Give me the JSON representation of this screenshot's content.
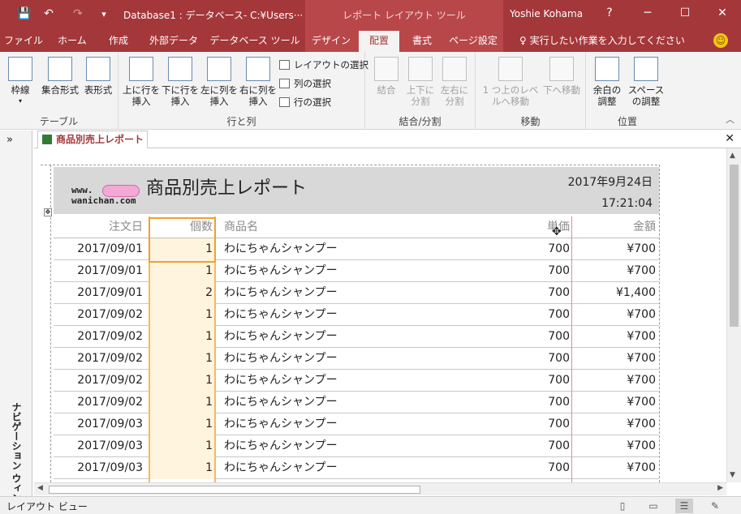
{
  "titlebar": {
    "doc_title": "Database1 : データベース- C:¥Users···",
    "context_title": "レポート レイアウト ツール",
    "user": "Yoshie Kohama",
    "help": "?",
    "minimize": "─",
    "maximize": "☐",
    "close": "✕",
    "save_icon": "💾",
    "undo_icon": "↶",
    "redo_icon": "↷",
    "customize_icon": "▾"
  },
  "tabs": [
    {
      "label": "ファイル"
    },
    {
      "label": "ホーム"
    },
    {
      "label": "作成"
    },
    {
      "label": "外部データ"
    },
    {
      "label": "データベース ツール"
    },
    {
      "label": "デザイン"
    },
    {
      "label": "配置"
    },
    {
      "label": "書式"
    },
    {
      "label": "ページ設定"
    }
  ],
  "tell_me": "♀ 実行したい作業を入力してください",
  "ribbon": {
    "groups": {
      "table": "テーブル",
      "rows_cols": "行と列",
      "merge": "結合/分割",
      "move": "移動",
      "position": "位置"
    },
    "buttons": {
      "gridlines": "枠線",
      "stacked": "集合形式",
      "tabular": "表形式",
      "insert_above": "上に行を挿入",
      "insert_below": "下に行を挿入",
      "insert_left": "左に列を挿入",
      "insert_right": "右に列を挿入",
      "select_layout": "レイアウトの選択",
      "select_column": "列の選択",
      "select_row": "行の選択",
      "merge": "結合",
      "split_vertical": "上下に分割",
      "split_horizontal": "左右に分割",
      "move_up": "1 つ上のレベルへ移動",
      "move_down": "下へ移動",
      "margins": "余白の調整",
      "padding": "スペースの調整"
    }
  },
  "nav_pane": {
    "toggle": "»",
    "label": "ナビゲーション ウィンドウ"
  },
  "document_tab": {
    "title": "商品別売上レポート",
    "close": "✕"
  },
  "report": {
    "logo_line1": "www.",
    "logo_line2": "wanichan.com",
    "title": "商品別売上レポート",
    "date": "2017年9月24日",
    "time": "17:21:04",
    "columns": [
      "注文日",
      "個数",
      "商品名",
      "単価",
      "金額"
    ],
    "rows": [
      [
        "2017/09/01",
        "1",
        "わにちゃんシャンプー",
        "700",
        "¥700"
      ],
      [
        "2017/09/01",
        "1",
        "わにちゃんシャンプー",
        "700",
        "¥700"
      ],
      [
        "2017/09/01",
        "2",
        "わにちゃんシャンプー",
        "700",
        "¥1,400"
      ],
      [
        "2017/09/02",
        "1",
        "わにちゃんシャンプー",
        "700",
        "¥700"
      ],
      [
        "2017/09/02",
        "1",
        "わにちゃんシャンプー",
        "700",
        "¥700"
      ],
      [
        "2017/09/02",
        "1",
        "わにちゃんシャンプー",
        "700",
        "¥700"
      ],
      [
        "2017/09/02",
        "1",
        "わにちゃんシャンプー",
        "700",
        "¥700"
      ],
      [
        "2017/09/02",
        "1",
        "わにちゃんシャンプー",
        "700",
        "¥700"
      ],
      [
        "2017/09/03",
        "1",
        "わにちゃんシャンプー",
        "700",
        "¥700"
      ],
      [
        "2017/09/03",
        "1",
        "わにちゃんシャンプー",
        "700",
        "¥700"
      ],
      [
        "2017/09/03",
        "1",
        "わにちゃんシャンプー",
        "700",
        "¥700"
      ]
    ]
  },
  "statusbar": {
    "label": "レイアウト ビュー"
  },
  "colors": {
    "accent": "#a4373a",
    "selection": "#f0a030"
  }
}
